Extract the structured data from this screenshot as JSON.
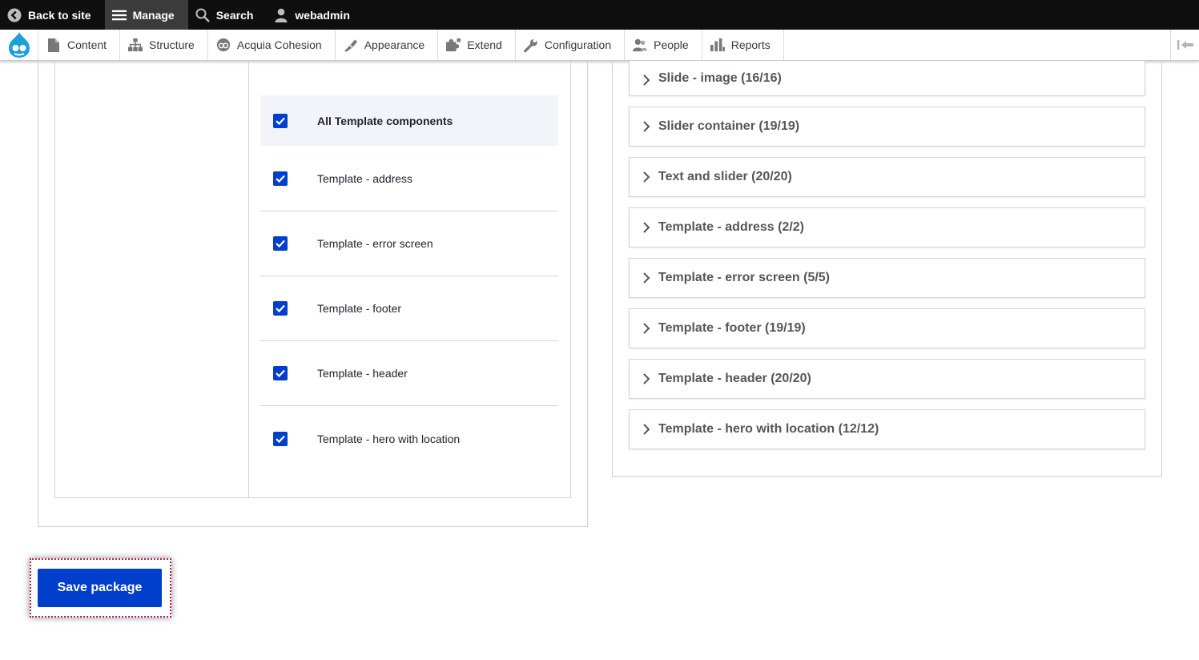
{
  "toolbar": {
    "back_label": "Back to site",
    "manage_label": "Manage",
    "search_label": "Search",
    "user_label": "webadmin"
  },
  "tray": {
    "items": [
      {
        "label": "Content",
        "icon": "page-icon"
      },
      {
        "label": "Structure",
        "icon": "sitemap-icon"
      },
      {
        "label": "Acquia Cohesion",
        "icon": "cohesion-icon"
      },
      {
        "label": "Appearance",
        "icon": "paintbrush-icon"
      },
      {
        "label": "Extend",
        "icon": "puzzle-icon"
      },
      {
        "label": "Configuration",
        "icon": "wrench-icon"
      },
      {
        "label": "People",
        "icon": "people-icon"
      },
      {
        "label": "Reports",
        "icon": "bar-chart-icon"
      }
    ]
  },
  "checklist": {
    "all_label": "All Template components",
    "items": [
      {
        "label": "Template - address",
        "checked": true
      },
      {
        "label": "Template - error screen",
        "checked": true
      },
      {
        "label": "Template - footer",
        "checked": true
      },
      {
        "label": "Template - header",
        "checked": true
      },
      {
        "label": "Template - hero with location",
        "checked": true
      }
    ]
  },
  "accordions": [
    "Slide - image (16/16)",
    "Slider container (19/19)",
    "Text and slider (20/20)",
    "Template - address (2/2)",
    "Template - error screen (5/5)",
    "Template - footer (19/19)",
    "Template - header (20/20)",
    "Template - hero with location (12/12)"
  ],
  "actions": {
    "save_label": "Save package"
  },
  "colors": {
    "primary": "#003ecc",
    "toolbar_bg": "#0f0f0f",
    "focus_ring": "#c2185b"
  }
}
